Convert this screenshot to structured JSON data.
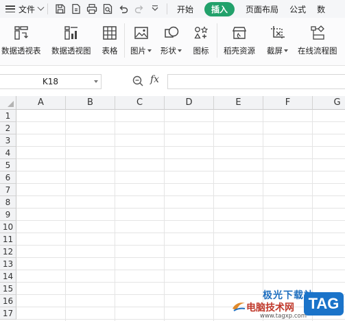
{
  "menubar": {
    "file_label": "文件",
    "tabs": [
      {
        "label": "开始",
        "active": false
      },
      {
        "label": "插入",
        "active": true
      },
      {
        "label": "页面布局",
        "active": false
      },
      {
        "label": "公式",
        "active": false
      },
      {
        "label": "数",
        "active": false
      }
    ]
  },
  "ribbon": {
    "buttons": [
      {
        "name": "pivot-table",
        "label": "数据透视表",
        "icon": "pivot-table-icon",
        "dropdown": false
      },
      {
        "name": "pivot-chart",
        "label": "数据透视图",
        "icon": "pivot-chart-icon",
        "dropdown": false
      },
      {
        "name": "table",
        "label": "表格",
        "icon": "table-icon",
        "dropdown": false
      },
      {
        "name": "picture",
        "label": "图片",
        "icon": "picture-icon",
        "dropdown": true
      },
      {
        "name": "shape",
        "label": "形状",
        "icon": "shape-icon",
        "dropdown": true
      },
      {
        "name": "icon",
        "label": "图标",
        "icon": "icons-icon",
        "dropdown": false
      },
      {
        "name": "docer-resource",
        "label": "稻壳资源",
        "icon": "store-icon",
        "dropdown": false
      },
      {
        "name": "screenshot",
        "label": "截屏",
        "icon": "screenshot-icon",
        "dropdown": true
      },
      {
        "name": "online-flowchart",
        "label": "在线流程图",
        "icon": "flowchart-icon",
        "dropdown": false
      }
    ]
  },
  "formula_bar": {
    "name_box": "K18",
    "fx_label": "fx",
    "formula_value": ""
  },
  "sheet": {
    "columns": [
      "A",
      "B",
      "C",
      "D",
      "E",
      "F",
      "G"
    ],
    "rows": [
      "1",
      "2",
      "3",
      "4",
      "5",
      "6",
      "7",
      "8",
      "9",
      "10",
      "11",
      "12",
      "13",
      "14",
      "15",
      "16",
      "17"
    ]
  },
  "watermark": {
    "title": "极光下载站",
    "name": "电脑技术网",
    "url": "www.tagxp.com",
    "tag": "TAG"
  },
  "colors": {
    "active_tab": "#22a16b",
    "grid_line": "#e4e4e4",
    "header_bg": "#f2f3f5"
  }
}
